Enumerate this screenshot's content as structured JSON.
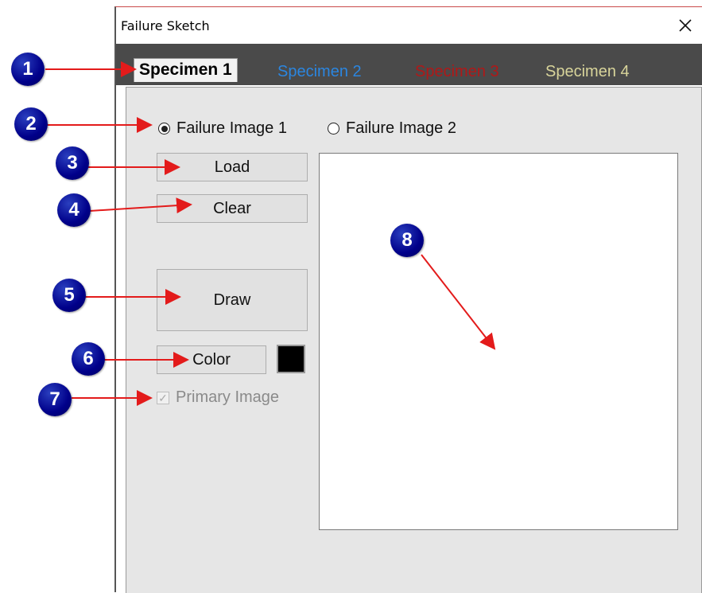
{
  "window": {
    "title": "Failure Sketch"
  },
  "tabs": [
    {
      "label": "Specimen 1",
      "color": "#000000",
      "active": true
    },
    {
      "label": "Specimen 2",
      "color": "#2b86e0",
      "active": false
    },
    {
      "label": "Specimen 3",
      "color": "#b01818",
      "active": false
    },
    {
      "label": "Specimen 4",
      "color": "#d8d49a",
      "active": false
    }
  ],
  "panel": {
    "radio_image1": {
      "label": "Failure Image 1",
      "checked": true
    },
    "radio_image2": {
      "label": "Failure Image 2",
      "checked": false
    },
    "load_label": "Load",
    "clear_label": "Clear",
    "draw_label": "Draw",
    "color_label": "Color",
    "color_swatch": "#000000",
    "primary_image": {
      "label": "Primary Image",
      "checked": true,
      "enabled": false
    }
  },
  "callouts": [
    "1",
    "2",
    "3",
    "4",
    "5",
    "6",
    "7",
    "8"
  ],
  "colors": {
    "callout": "#00008a",
    "arrow": "#e31b1b",
    "tabstrip": "#4a4a4a",
    "panel": "#e6e6e6"
  },
  "icons": {
    "close": "close-icon"
  }
}
